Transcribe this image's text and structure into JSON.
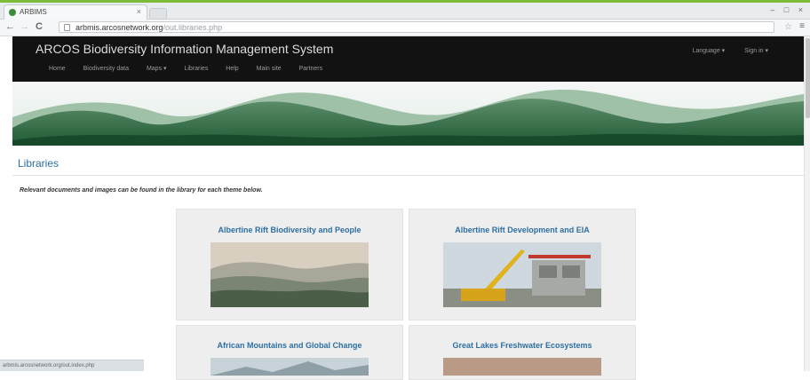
{
  "browser": {
    "tab_title": "ARBIMS",
    "tab_close": "×",
    "window_controls": "– □ ×",
    "back": "←",
    "forward": "→",
    "reload": "C",
    "url_host": "arbmis.arcosnetwork.org",
    "url_path": "/out.libraries.php",
    "star": "☆",
    "menu": "≡",
    "status_text": "arbmis.arcosnetwork.org/out.index.php"
  },
  "site": {
    "brand": "ARCOS Biodiversity Information Management System",
    "nav": [
      "Home",
      "Biodiversity data",
      "Maps ▾",
      "Libraries",
      "Help",
      "Main site",
      "Partners"
    ],
    "language": "Language ▾",
    "sign_in": "Sign in ▾"
  },
  "page": {
    "title": "Libraries",
    "intro": "Relevant documents and images can be found in the library for each theme below.",
    "cards": [
      {
        "title": "Albertine Rift Biodiversity and People"
      },
      {
        "title": "Albertine Rift Development and EIA"
      },
      {
        "title": "African Mountains and Global Change"
      },
      {
        "title": "Great Lakes Freshwater Ecosystems"
      }
    ]
  },
  "colors": {
    "accent": "#2d6fa3",
    "navbar": "#121212",
    "card": "#eeeeee"
  }
}
